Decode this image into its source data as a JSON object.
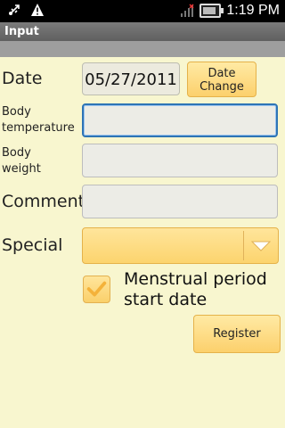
{
  "status_bar": {
    "time": "1:19 PM",
    "icons": [
      "usb-icon",
      "warning-icon",
      "signal-icon",
      "battery-icon"
    ]
  },
  "title_bar": {
    "title": "Input"
  },
  "form": {
    "date": {
      "label": "Date",
      "value": "05/27/2011",
      "change_button": "Date\nChange"
    },
    "body_temperature": {
      "label": "Body\ntemperature",
      "value": ""
    },
    "body_weight": {
      "label": "Body\nweight",
      "value": ""
    },
    "comment": {
      "label": "Comment",
      "value": ""
    },
    "special": {
      "label": "Special",
      "selected": ""
    },
    "menstrual": {
      "label": "Menstrual period\nstart date",
      "checked": true
    },
    "register_button": "Register"
  },
  "colors": {
    "background": "#f8f6cf",
    "accent_button": "#fcd06c",
    "focus_border": "#2e74b5"
  }
}
